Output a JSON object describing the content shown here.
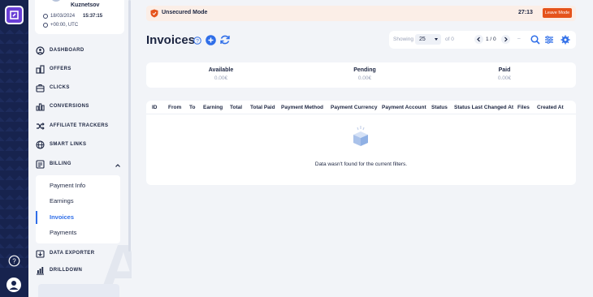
{
  "profile": {
    "name": "Kuznetsov",
    "date": "18/03/2024",
    "time": "15:37:15",
    "timezone": "+00:00, UTC"
  },
  "nav": {
    "items": [
      {
        "label": "DASHBOARD",
        "icon": "dashboard-icon"
      },
      {
        "label": "OFFERS",
        "icon": "offers-icon"
      },
      {
        "label": "CLICKS",
        "icon": "briefcase-icon"
      },
      {
        "label": "CONVERSIONS",
        "icon": "bar-chart-icon"
      },
      {
        "label": "AFFILIATE TRACKERS",
        "icon": "shuffle-icon"
      },
      {
        "label": "SMART LINKS",
        "icon": "globe-icon"
      },
      {
        "label": "BILLING",
        "icon": "billing-icon"
      },
      {
        "label": "DATA EXPORTER",
        "icon": "export-icon"
      },
      {
        "label": "DRILLDOWN",
        "icon": "drilldown-icon"
      }
    ],
    "billing_sub": [
      "Payment Info",
      "Earnings",
      "Invoices",
      "Payments"
    ],
    "active_sub": "Invoices"
  },
  "banner": {
    "text": "Unsecured Mode",
    "timer": "27:13",
    "button": "Leave Mode"
  },
  "page": {
    "title": "Invoices"
  },
  "pager": {
    "showing_label": "Showing",
    "per_page": "25",
    "of_label": "of 0",
    "page_label": "1 / 0",
    "dash": "–"
  },
  "summary": {
    "available_label": "Available",
    "available_value": "0.00€",
    "pending_label": "Pending",
    "pending_value": "0.00€",
    "paid_label": "Paid",
    "paid_value": "0.00€"
  },
  "table": {
    "columns": [
      "ID",
      "From",
      "To",
      "Earning",
      "Total",
      "Total Paid",
      "Payment Method",
      "Payment Currency",
      "Payment Account",
      "Status",
      "Status Last Changed At",
      "Files",
      "Created At"
    ],
    "empty_text": "Data wasn't found for the current filters."
  },
  "colors": {
    "accent": "#2f6ee8",
    "rail": "#17234e",
    "warning": "#e5531c"
  }
}
